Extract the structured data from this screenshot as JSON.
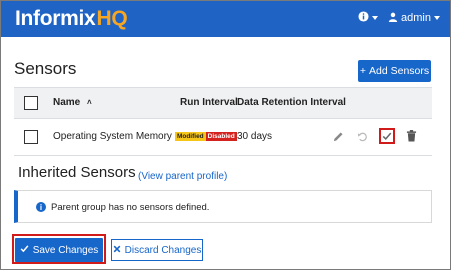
{
  "header": {
    "logo_main": "Informix",
    "logo_accent": "HQ",
    "info_icon": "info-icon",
    "user_icon": "user-icon",
    "user_name": "admin"
  },
  "page": {
    "title": "Sensors",
    "add_button_label": "Add Sensors"
  },
  "table": {
    "columns": [
      "Name",
      "Run Interval",
      "Data Retention Interval"
    ],
    "sort_indicator": "˄",
    "rows": [
      {
        "name": "Operating System Memory",
        "badges": [
          "Modified",
          "Disabled"
        ],
        "run_interval": "",
        "retention": "30 days",
        "actions": [
          "pencil-icon",
          "undo-icon",
          "check-icon",
          "trash-icon"
        ]
      }
    ]
  },
  "inherited": {
    "title": "Inherited Sensors",
    "link_text": "(View parent profile)",
    "info_message": "Parent group has no sensors defined."
  },
  "footer": {
    "save_label": "Save Changes",
    "discard_label": "Discard Changes"
  },
  "colors": {
    "brand_blue": "#1f63c4",
    "accent_orange": "#f6a623",
    "highlight_red": "#d11a1a",
    "badge_modified": "#f5c518",
    "badge_disabled": "#d4231e"
  }
}
